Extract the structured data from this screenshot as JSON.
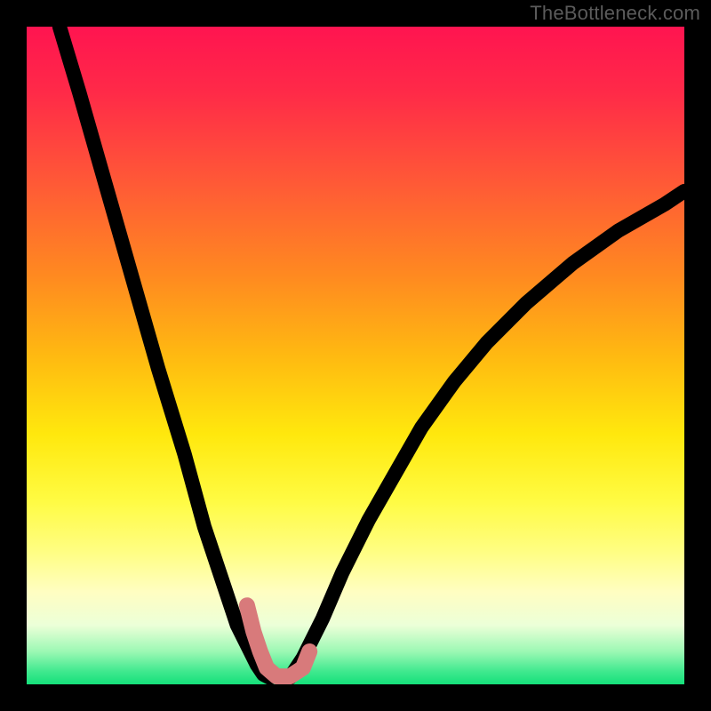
{
  "watermark": "TheBottleneck.com",
  "chart_data": {
    "type": "line",
    "title": "",
    "xlabel": "",
    "ylabel": "",
    "xlim": [
      0,
      100
    ],
    "ylim": [
      0,
      100
    ],
    "grid": false,
    "legend": false,
    "background": {
      "type": "vertical-gradient",
      "top_color": "#ff1450",
      "bottom_color": "#14e07a",
      "note": "Red at top through orange/yellow to green at bottom"
    },
    "series": [
      {
        "name": "left-branch",
        "description": "Steep descending curve from upper-left toward a minimum near x≈37",
        "x": [
          5,
          8,
          12,
          16,
          20,
          24,
          27,
          30,
          32,
          34,
          35,
          36,
          37
        ],
        "y": [
          100,
          90,
          76,
          62,
          48,
          35,
          24,
          15,
          9,
          5,
          3,
          1.5,
          1
        ]
      },
      {
        "name": "right-branch",
        "description": "Rising curve from the minimum near x≈40 toward upper-right, flattening as x grows",
        "x": [
          40,
          42,
          45,
          48,
          52,
          56,
          60,
          65,
          70,
          76,
          83,
          90,
          97,
          100
        ],
        "y": [
          1,
          4,
          10,
          17,
          25,
          32,
          39,
          46,
          52,
          58,
          64,
          69,
          73,
          75
        ]
      },
      {
        "name": "highlight-marker",
        "description": "Thick pink L-shaped overlay near the curve minimum",
        "color": "#d87a7b",
        "x": [
          33.5,
          34.5,
          35.5,
          36.5,
          38,
          40,
          42,
          43
        ],
        "y": [
          12,
          8,
          5,
          2.5,
          1.2,
          1.2,
          2.5,
          5
        ]
      }
    ],
    "notes": "Values are read/estimated from pixel positions against a 0–100 normalized axis; no numeric tick labels are present in the image."
  }
}
